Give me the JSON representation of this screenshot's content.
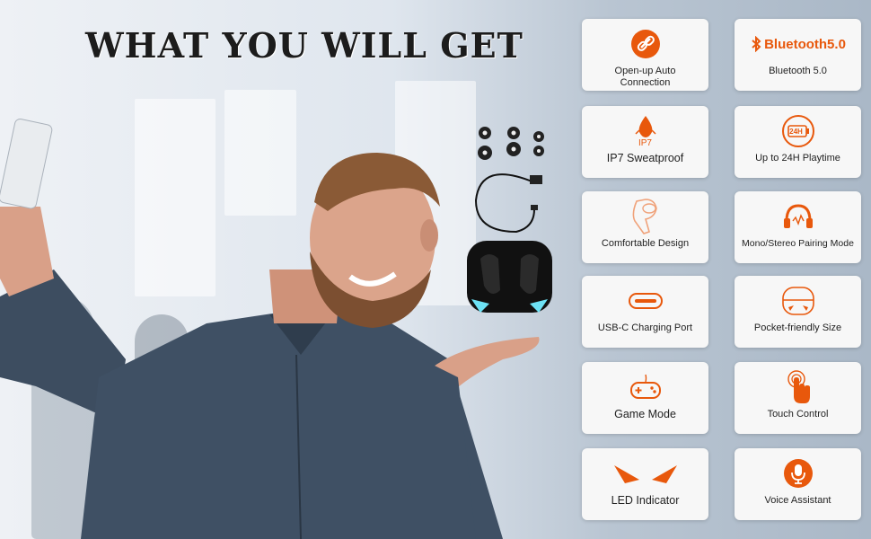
{
  "headline": "WHAT YOU WILL GET",
  "colors": {
    "accent": "#e8580c",
    "card_bg": "#f7f7f7",
    "text": "#222222"
  },
  "features": [
    {
      "icon": "link-icon",
      "label": "Open-up Auto Connection"
    },
    {
      "icon": "bluetooth-icon",
      "label": "Bluetooth 5.0",
      "logo_text": "Bluetooth5.0"
    },
    {
      "icon": "water-drop-icon",
      "label": "IP7 Sweatproof",
      "badge": "IP7"
    },
    {
      "icon": "battery-icon",
      "label": "Up to 24H Playtime",
      "badge": "24H"
    },
    {
      "icon": "earbud-icon",
      "label": "Comfortable Design"
    },
    {
      "icon": "headphones-icon",
      "label": "Mono/Stereo Pairing Mode"
    },
    {
      "icon": "usb-c-icon",
      "label": "USB-C Charging Port"
    },
    {
      "icon": "case-icon",
      "label": "Pocket-friendly Size"
    },
    {
      "icon": "gamepad-icon",
      "label": "Game Mode"
    },
    {
      "icon": "touch-icon",
      "label": "Touch Control"
    },
    {
      "icon": "led-eyes-icon",
      "label": "LED Indicator"
    },
    {
      "icon": "microphone-icon",
      "label": "Voice Assistant"
    }
  ]
}
